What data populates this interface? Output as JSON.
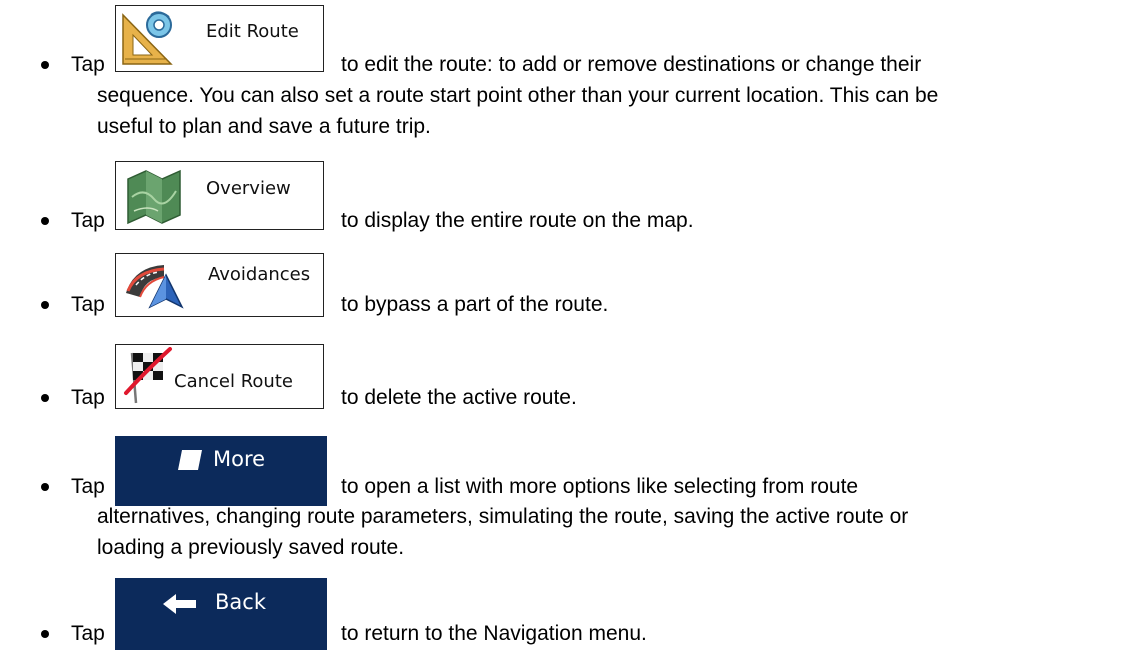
{
  "items": [
    {
      "tap": "Tap",
      "button_label": "Edit Route",
      "icon": "set-square-icon",
      "text": "to edit the route: to add or remove destinations or change their",
      "continuation": [
        "sequence. You can also set a route start point other than your current location. This can be",
        "useful to plan and save a future trip."
      ]
    },
    {
      "tap": "Tap",
      "button_label": "Overview",
      "icon": "map-icon",
      "text": "to display the entire route on the map."
    },
    {
      "tap": "Tap",
      "button_label": "Avoidances",
      "icon": "road-avoid-icon",
      "text": "to bypass a part of the route."
    },
    {
      "tap": "Tap",
      "button_label": "Cancel Route",
      "icon": "checkered-flag-cancel-icon",
      "text": "to delete the active route."
    },
    {
      "tap": "Tap",
      "button_label": "More",
      "icon": "square-more-icon",
      "text": "to open a list with more options like selecting from route",
      "continuation": [
        "alternatives, changing route parameters, simulating the route, saving the active route or",
        "loading a previously saved route."
      ]
    },
    {
      "tap": "Tap",
      "button_label": "Back",
      "icon": "back-arrow-icon",
      "text": "to return to the Navigation menu."
    }
  ],
  "colors": {
    "button_dark_blue": "#0c2a5b",
    "text": "#000000"
  }
}
